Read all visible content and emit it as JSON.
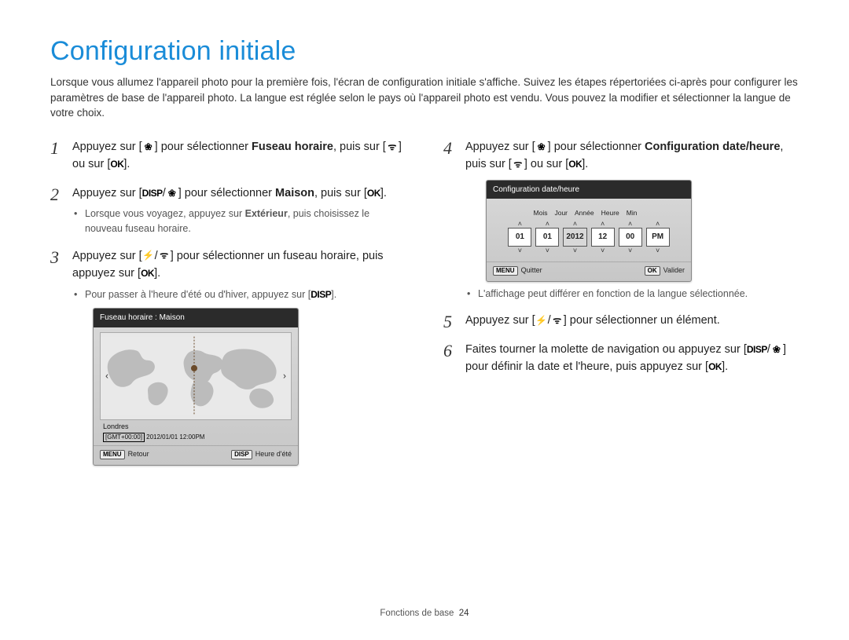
{
  "title": "Configuration initiale",
  "intro": "Lorsque vous allumez l'appareil photo pour la première fois, l'écran de configuration initiale s'affiche. Suivez les étapes répertoriées ci-après pour configurer les paramètres de base de l'appareil photo. La langue est réglée selon le pays où l'appareil photo est vendu. Vous pouvez la modifier et sélectionner la langue de votre choix.",
  "icons": {
    "macro": "❀",
    "wifi": "ᯤ",
    "ok": "OK",
    "disp": "DISP",
    "flash": "⚡",
    "menu": "MENU"
  },
  "steps_left": {
    "s1": {
      "p1": "Appuyez sur [",
      "p2": "] pour sélectionner ",
      "bold": "Fuseau horaire",
      "p3": ", puis sur [",
      "p4": "] ou sur [",
      "p5": "]."
    },
    "s2": {
      "p1": "Appuyez sur [",
      "p2": "/",
      "p3": "] pour sélectionner ",
      "bold": "Maison",
      "p4": ", puis sur [",
      "p5": "].",
      "note_a": "Lorsque vous voyagez, appuyez sur ",
      "note_bold": "Extérieur",
      "note_b": ", puis choisissez le nouveau fuseau horaire."
    },
    "s3": {
      "p1": "Appuyez sur [",
      "p2": "/",
      "p3": "] pour sélectionner un fuseau horaire, puis appuyez sur [",
      "p4": "].",
      "note_a": "Pour passer à l'heure d'été ou d'hiver, appuyez sur [",
      "note_b": "]."
    }
  },
  "steps_right": {
    "start_index": 4,
    "s4": {
      "p1": "Appuyez sur [",
      "p2": "] pour sélectionner ",
      "bold": "Configuration date/heure",
      "p3": ", puis sur [",
      "p4": "] ou sur [",
      "p5": "].",
      "note": "L'affichage peut différer en fonction de la langue sélectionnée."
    },
    "s5": {
      "p1": "Appuyez sur [",
      "p2": "/",
      "p3": "] pour sélectionner un élément."
    },
    "s6": {
      "p1": "Faites tourner la molette de navigation ou appuyez sur [",
      "p2": "/",
      "p3": "] pour définir la date et l'heure, puis appuyez sur [",
      "p4": "]."
    }
  },
  "lcd_map": {
    "title": "Fuseau horaire : Maison",
    "city": "Londres",
    "gmt": "[GMT+00:00]",
    "stamp": "2012/01/01 12:00PM",
    "foot_left": "Retour",
    "foot_right": "Heure d'été"
  },
  "lcd_date": {
    "title": "Configuration date/heure",
    "labels": [
      "Mois",
      "Jour",
      "Année",
      "Heure",
      "Min",
      ""
    ],
    "values": [
      "01",
      "01",
      "2012",
      "12",
      "00",
      "PM"
    ],
    "selected_index": 2,
    "foot_left": "Quitter",
    "foot_right": "Valider"
  },
  "footer": {
    "section": "Fonctions de base",
    "page": "24"
  }
}
